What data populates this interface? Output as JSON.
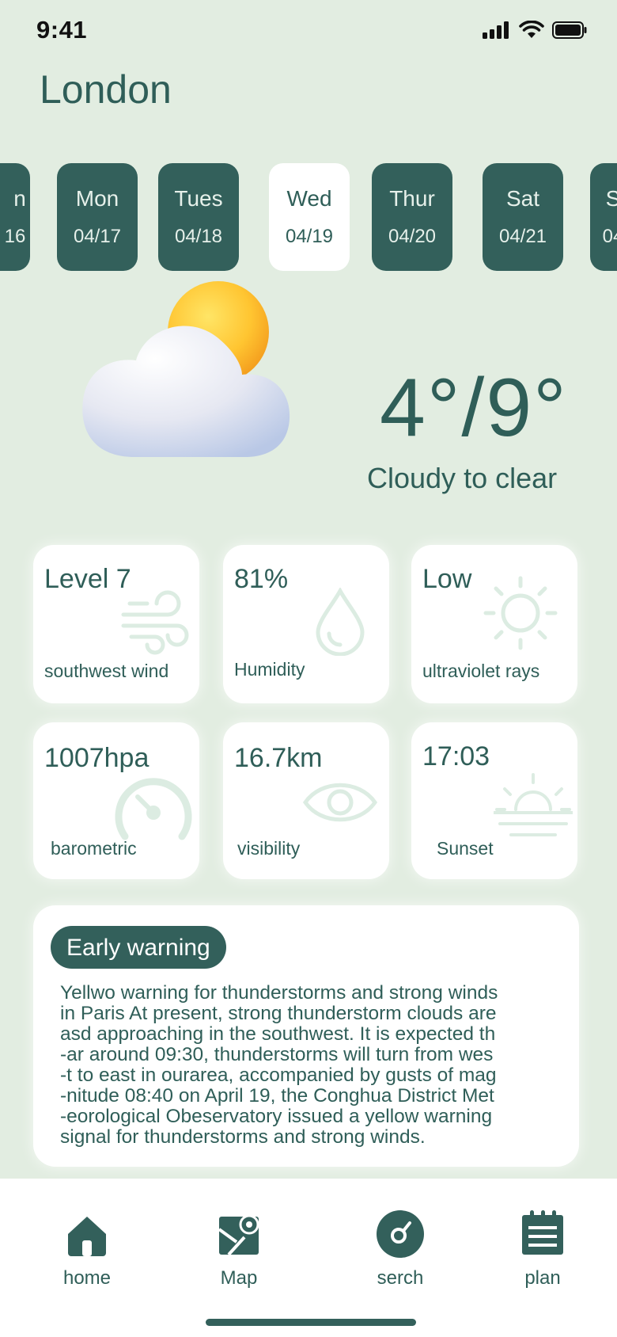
{
  "status_bar": {
    "time": "9:41"
  },
  "city": "London",
  "days": [
    {
      "name": "n",
      "date": "16",
      "active": false
    },
    {
      "name": "Mon",
      "date": "04/17",
      "active": false
    },
    {
      "name": "Tues",
      "date": "04/18",
      "active": false
    },
    {
      "name": "Wed",
      "date": "04/19",
      "active": true
    },
    {
      "name": "Thur",
      "date": "04/20",
      "active": false
    },
    {
      "name": "Sat",
      "date": "04/21",
      "active": false
    },
    {
      "name": "S",
      "date": "04",
      "active": false
    }
  ],
  "weather": {
    "icon": "partly-cloudy-icon",
    "temperature": "4°/9°",
    "description": "Cloudy to clear"
  },
  "details": [
    {
      "value": "Level 7",
      "label": "southwest wind",
      "icon": "wind-icon"
    },
    {
      "value": "81%",
      "label": "Humidity",
      "icon": "droplet-icon"
    },
    {
      "value": "Low",
      "label": "ultraviolet rays",
      "icon": "sun-icon"
    },
    {
      "value": "1007hpa",
      "label": "barometric",
      "icon": "gauge-icon"
    },
    {
      "value": "16.7km",
      "label": "visibility",
      "icon": "eye-icon"
    },
    {
      "value": "17:03",
      "label": "Sunset",
      "icon": "sunset-icon"
    }
  ],
  "warning": {
    "badge": "Early warning",
    "text": "Yellwo warning for thunderstorms and strong winds\nin Paris At present, strong thunderstorm clouds are\nasd approaching in the southwest. It is expected th\n-ar around 09:30, thunderstorms will turn from wes\n-t to east in ourarea, accompanied by gusts of mag\n-nitude 08:40 on April 19, the Conghua District Met\n-eorological Obeservatory issued a yellow warning\nsignal for thunderstorms and strong winds."
  },
  "tabs": [
    {
      "label": "home",
      "icon": "home-icon"
    },
    {
      "label": "Map",
      "icon": "map-icon"
    },
    {
      "label": "serch",
      "icon": "search-icon"
    },
    {
      "label": "plan",
      "icon": "plan-icon"
    }
  ],
  "colors": {
    "background": "#e2ede1",
    "accent": "#33605b",
    "text": "#2f5e58"
  }
}
